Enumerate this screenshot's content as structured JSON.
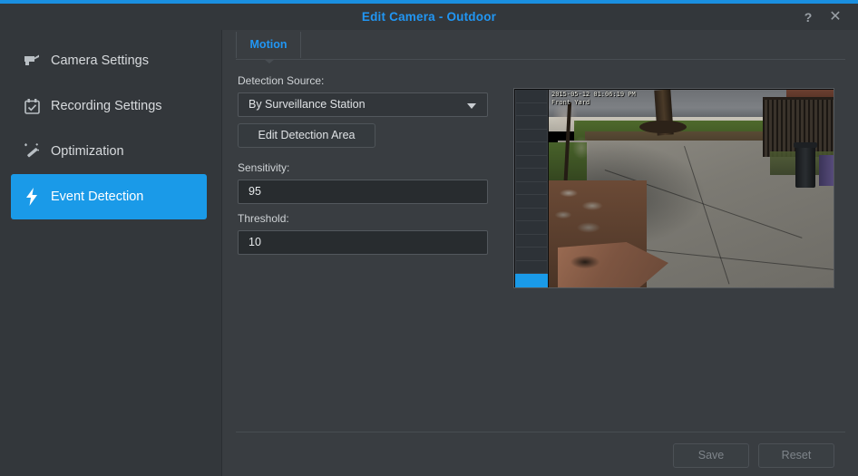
{
  "window": {
    "title": "Edit Camera - Outdoor",
    "help_label": "?",
    "close_label": "✕",
    "accent_color": "#1a8fe0",
    "title_color": "#2196f3"
  },
  "sidebar": {
    "items": [
      {
        "label": "Camera Settings",
        "icon": "camera-icon",
        "active": false
      },
      {
        "label": "Recording Settings",
        "icon": "calendar-check-icon",
        "active": false
      },
      {
        "label": "Optimization",
        "icon": "magic-wand-icon",
        "active": false
      },
      {
        "label": "Event Detection",
        "icon": "lightning-bolt-icon",
        "active": true
      }
    ],
    "active_color": "#1a9ae8"
  },
  "tabs": [
    {
      "label": "Motion",
      "active": true
    }
  ],
  "form": {
    "detection_source_label": "Detection Source:",
    "detection_source_value": "By Surveillance Station",
    "edit_area_button": "Edit Detection Area",
    "sensitivity_label": "Sensitivity:",
    "sensitivity_value": "95",
    "threshold_label": "Threshold:",
    "threshold_value": "10"
  },
  "preview": {
    "osd_line1": "2015-05-12 01:06:19 PM",
    "osd_line2": "Front Yard",
    "meter_cells": 15,
    "meter_filled": 1,
    "meter_color": "#1a9ae8"
  },
  "footer": {
    "save_label": "Save",
    "reset_label": "Reset"
  }
}
